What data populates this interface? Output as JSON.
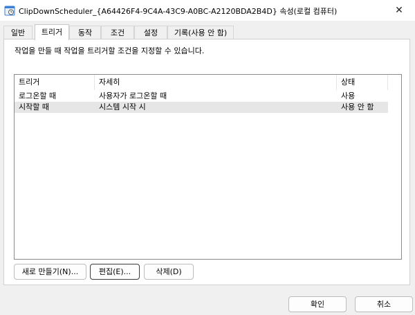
{
  "window": {
    "title": "ClipDownScheduler_{A64426F4-9C4A-43C9-A0BC-A2120BDA2B4D} 속성(로컬 컴퓨터)",
    "close_glyph": "✕"
  },
  "tabs": [
    {
      "label": "일반",
      "active": false
    },
    {
      "label": "트리거",
      "active": true
    },
    {
      "label": "동작",
      "active": false
    },
    {
      "label": "조건",
      "active": false
    },
    {
      "label": "설정",
      "active": false
    },
    {
      "label": "기록(사용 안 함)",
      "active": false
    }
  ],
  "triggers_tab": {
    "description": "작업을 만들 때 작업을 트리거할 조건을 지정할 수 있습니다.",
    "columns": [
      "트리거",
      "자세히",
      "상태"
    ],
    "rows": [
      {
        "trigger": "로그온할 때",
        "details": "사용자가 로그온할 때",
        "status": "사용",
        "selected": false
      },
      {
        "trigger": "시작할 때",
        "details": "시스템 시작 시",
        "status": "사용 안 함",
        "selected": true
      }
    ],
    "buttons": {
      "new": "새로 만들기(N)...",
      "edit": "편집(E)...",
      "delete": "삭제(D)"
    }
  },
  "dialog_buttons": {
    "ok": "확인",
    "cancel": "취소"
  },
  "colors": {
    "window_bg": "#f0f0f0",
    "panel_bg": "#ffffff",
    "selected_row": "#e6e6e6",
    "icon_accent": "#3b7fd6"
  },
  "icons": {
    "app": "scheduler-clock-icon",
    "close": "close-icon"
  }
}
